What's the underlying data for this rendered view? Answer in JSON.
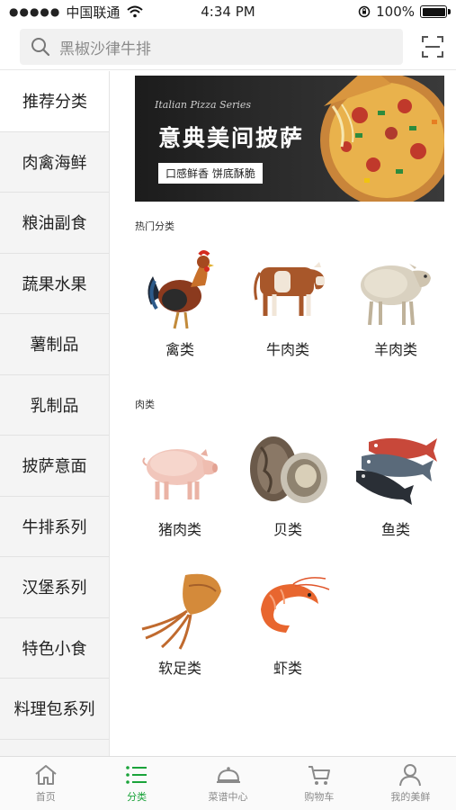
{
  "status": {
    "carrier": "中国联通",
    "time": "4:34 PM",
    "battery": "100%",
    "battery_level": 1.0
  },
  "search": {
    "placeholder": "黑椒沙律牛排"
  },
  "sidebar": {
    "items": [
      {
        "label": "推荐分类",
        "active": true
      },
      {
        "label": "肉禽海鲜"
      },
      {
        "label": "粮油副食"
      },
      {
        "label": "蔬果水果"
      },
      {
        "label": "薯制品"
      },
      {
        "label": "乳制品"
      },
      {
        "label": "披萨意面"
      },
      {
        "label": "牛排系列"
      },
      {
        "label": "汉堡系列"
      },
      {
        "label": "特色小食"
      },
      {
        "label": "料理包系列"
      }
    ]
  },
  "banner": {
    "eng_title": "Italian Pizza Series",
    "title": "意典美间披萨",
    "tag": "口感鲜香 饼底酥脆"
  },
  "sections": [
    {
      "title": "热门分类",
      "items": [
        {
          "label": "禽类",
          "icon": "rooster-image"
        },
        {
          "label": "牛肉类",
          "icon": "cow-image"
        },
        {
          "label": "羊肉类",
          "icon": "sheep-image"
        }
      ]
    },
    {
      "title": "肉类",
      "items": [
        {
          "label": "猪肉类",
          "icon": "pig-image"
        },
        {
          "label": "贝类",
          "icon": "oyster-image"
        },
        {
          "label": "鱼类",
          "icon": "fish-image"
        },
        {
          "label": "软足类",
          "icon": "squid-image"
        },
        {
          "label": "虾类",
          "icon": "shrimp-image"
        }
      ]
    }
  ],
  "tabs": [
    {
      "label": "首页",
      "icon": "home-icon"
    },
    {
      "label": "分类",
      "icon": "list-icon",
      "active": true
    },
    {
      "label": "菜谱中心",
      "icon": "cloche-icon"
    },
    {
      "label": "购物车",
      "icon": "cart-icon"
    },
    {
      "label": "我的美鲜",
      "icon": "user-icon"
    }
  ],
  "colors": {
    "accent": "#1aa33a",
    "sidebar_bg": "#f4f4f4",
    "tab_inactive": "#8a8a8a"
  }
}
